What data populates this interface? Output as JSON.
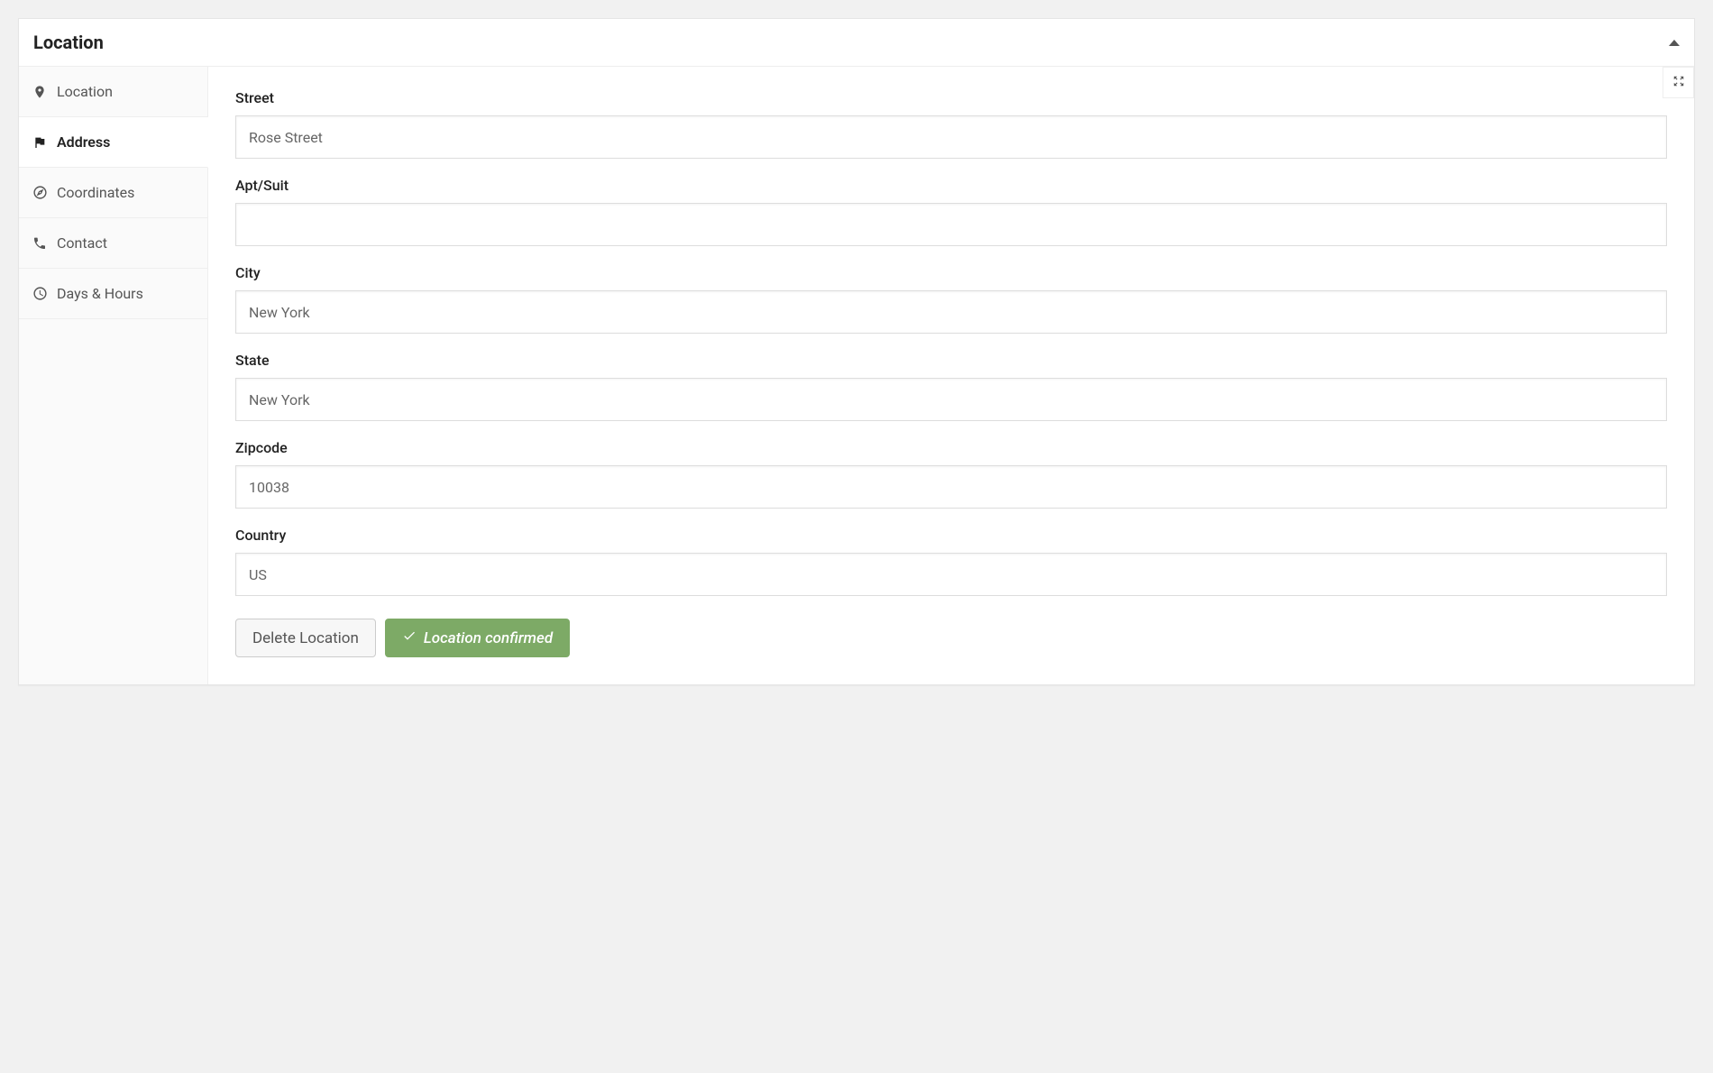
{
  "panel": {
    "title": "Location"
  },
  "sidebar": {
    "items": [
      {
        "label": "Location"
      },
      {
        "label": "Address"
      },
      {
        "label": "Coordinates"
      },
      {
        "label": "Contact"
      },
      {
        "label": "Days & Hours"
      }
    ]
  },
  "form": {
    "street": {
      "label": "Street",
      "value": "Rose Street"
    },
    "apt": {
      "label": "Apt/Suit",
      "value": ""
    },
    "city": {
      "label": "City",
      "value": "New York"
    },
    "state": {
      "label": "State",
      "value": "New York"
    },
    "zipcode": {
      "label": "Zipcode",
      "value": "10038"
    },
    "country": {
      "label": "Country",
      "value": "US"
    }
  },
  "actions": {
    "delete": "Delete Location",
    "confirmed": "Location confirmed"
  }
}
